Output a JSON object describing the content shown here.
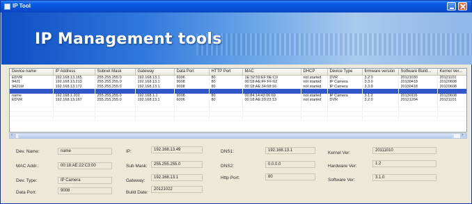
{
  "window": {
    "title": "IP Tool"
  },
  "banner": {
    "title": "IP Management tools"
  },
  "table": {
    "columns": [
      "Device name",
      "IP Address",
      "Subnet Mask",
      "Gateway",
      "Data Port",
      "HTTP Port",
      "MAC",
      "DHCP",
      "Device Type",
      "firmware version",
      "Software Build...",
      "Kernel Ver..."
    ],
    "rows": [
      [
        "EDVR",
        "192.168.13.165",
        "255.255.255.0",
        "192.168.13.1",
        "6006",
        "80",
        "1E:32:59:EF:6E:C0",
        "not started",
        "DVR",
        "3.2.0",
        "20121030",
        "20121101"
      ],
      [
        "9421",
        "192.168.13.213",
        "255.255.255.0",
        "192.168.13.1",
        "9008",
        "80",
        "00:18:AE:FF:FF:62",
        "not started",
        "IP Camera",
        "3.3.0",
        "20130418",
        "20120608"
      ],
      [
        "9421M",
        "192.168.13.172",
        "255.255.255.0",
        "192.168.13.1",
        "9008",
        "80",
        "00:18:AE:34:68:16",
        "not started",
        "IP Camera",
        "3.3.0",
        "20130418",
        "20120608"
      ],
      [
        "",
        "",
        "",
        "",
        "",
        "",
        "",
        "",
        "",
        "",
        "",
        ""
      ],
      [
        "name",
        "192.168.1.202",
        "255.255.255.0",
        "192.168.1.1",
        "9008",
        "80",
        "00:84:14:43:06:69",
        "not started",
        "IP Camera",
        "3.1.2",
        "20130116",
        "20120608"
      ],
      [
        "EDVR",
        "192.168.13.167",
        "255.255.255.0",
        "192.168.13.1",
        "6006",
        "80",
        "00:18:AE:20:23:13",
        "not started",
        "DVR",
        "3.2.0",
        "20121204",
        "20121101"
      ]
    ],
    "selected_row": 3
  },
  "details": {
    "dev_name": {
      "label": "Dev. Name:",
      "value": "name"
    },
    "mac_addr": {
      "label": "MAC Addr.:",
      "value": "00:18:AE:22:C3:00"
    },
    "dev_type": {
      "label": "Dev. Type:",
      "value": "IP Camera"
    },
    "data_port": {
      "label": "Data Port:",
      "value": "9008"
    },
    "ip": {
      "label": "IP:",
      "value": "192.168.13.49"
    },
    "sub_mask": {
      "label": "Sub Mask:",
      "value": "255.255.255.0"
    },
    "gateway": {
      "label": "Gateway:",
      "value": "192.168.13.1"
    },
    "build_date": {
      "label": "Build Date:",
      "value": "20121022"
    },
    "dns1": {
      "label": "DNS1:",
      "value": "192.168.13.1"
    },
    "dns2": {
      "label": "DNS2:",
      "value": "0.0.0.0"
    },
    "http_port": {
      "label": "Http Port:",
      "value": "80"
    },
    "kernel_ver": {
      "label": "Kernel Ver:",
      "value": "20111010"
    },
    "hardware_ver": {
      "label": "Hardware Ver:",
      "value": "1.2"
    },
    "software_ver": {
      "label": "Software Ver:",
      "value": "3.1.0"
    }
  },
  "colors": {
    "titlebar": "#0650d8",
    "selection": "#3158c9",
    "banner": "#2f78dc"
  }
}
